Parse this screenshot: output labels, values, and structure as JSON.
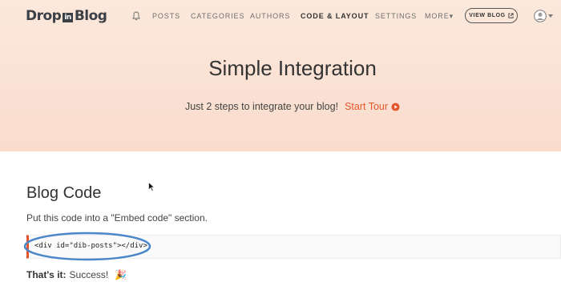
{
  "header": {
    "logo": {
      "part1": "Drop",
      "part2": "in",
      "part3": "Blog"
    },
    "nav": [
      {
        "label": "POSTS",
        "active": false
      },
      {
        "label": "CATEGORIES",
        "active": false
      },
      {
        "label": "AUTHORS",
        "active": false
      },
      {
        "label": "CODE & LAYOUT",
        "active": true
      },
      {
        "label": "SETTINGS",
        "active": false
      },
      {
        "label": "MORE▾",
        "active": false
      }
    ],
    "view_blog_label": "VIEW BLOG",
    "icons": {
      "bell": "bell-icon",
      "external": "external-link-icon",
      "avatar": "user-avatar-icon"
    }
  },
  "hero": {
    "title": "Simple Integration",
    "subtitle": "Just 2 steps to integrate your blog!",
    "tour_label": "Start Tour"
  },
  "main": {
    "section_title": "Blog Code",
    "instruction": "Put this code into a \"Embed code\" section.",
    "code": "<div id=\"dib-posts\"></div>",
    "success_label": "That's it:",
    "success_text": "Success!",
    "success_emoji": "🎉"
  },
  "colors": {
    "accent": "#e5562d",
    "highlight": "#4a86c8",
    "hero_bg": "#fadccd"
  }
}
